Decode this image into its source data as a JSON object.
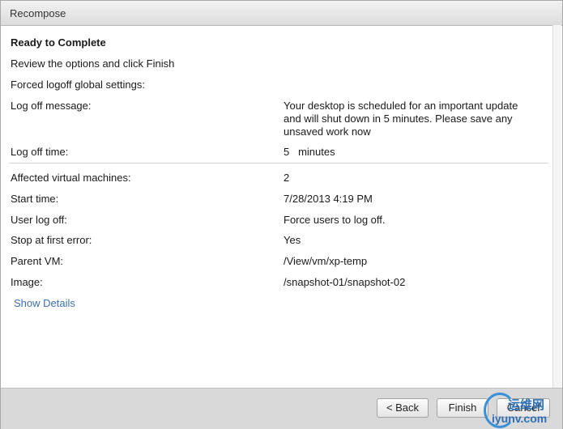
{
  "window": {
    "title": "Recompose"
  },
  "summary": {
    "heading": "Ready to Complete",
    "instruction": "Review the options and click Finish",
    "section_label": "Forced logoff global settings:",
    "logoff_message_label": "Log off message:",
    "logoff_message_lines": [
      "Your desktop is scheduled for an important update",
      "and will shut down in 5 minutes. Please save any",
      "unsaved work now"
    ],
    "logoff_time_label": "Log off time:",
    "logoff_time_value": "5   minutes",
    "details": [
      {
        "label": "Affected virtual machines:",
        "value": "2"
      },
      {
        "label": "Start time:",
        "value": "7/28/2013 4:19 PM"
      },
      {
        "label": "User log off:",
        "value": "Force users to log off."
      },
      {
        "label": "Stop at first error:",
        "value": "Yes"
      },
      {
        "label": "Parent VM:",
        "value": "/View/vm/xp-temp"
      },
      {
        "label": "Image:",
        "value": "/snapshot-01/snapshot-02"
      }
    ],
    "show_details_link": "Show Details"
  },
  "footer": {
    "back_label": "< Back",
    "finish_label": "Finish",
    "cancel_label": "Cancel"
  },
  "watermark": {
    "cn": "运维网",
    "en": "iyunv.com"
  }
}
